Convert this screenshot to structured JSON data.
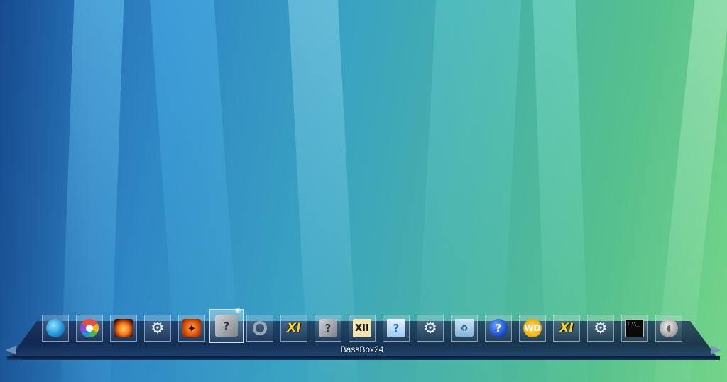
{
  "desktop": {
    "wallpaper": "aurora-streaks",
    "colors": {
      "left": "#1f5fa8",
      "mid": "#47b0a8",
      "right": "#74d488"
    }
  },
  "dock": {
    "hover_label": "BassBox24",
    "items": [
      {
        "name": "refresh-icon",
        "glyph": ""
      },
      {
        "name": "picasa-icon",
        "glyph": ""
      },
      {
        "name": "fire-icon",
        "glyph": ""
      },
      {
        "name": "gear-icon",
        "glyph": "⚙"
      },
      {
        "name": "orange-app-icon",
        "glyph": "✦"
      },
      {
        "name": "unknown-box-icon",
        "glyph": "?"
      },
      {
        "name": "circular-arrow-icon",
        "glyph": ""
      },
      {
        "name": "xi-icon",
        "glyph": "XI"
      },
      {
        "name": "unknown-box-icon",
        "glyph": "?"
      },
      {
        "name": "xii-icon",
        "glyph": "XII"
      },
      {
        "name": "help-document-icon",
        "glyph": "?"
      },
      {
        "name": "gear-icon",
        "glyph": "⚙"
      },
      {
        "name": "recycle-bin-icon",
        "glyph": "♻"
      },
      {
        "name": "help-icon",
        "glyph": "?"
      },
      {
        "name": "wd-icon",
        "glyph": "WD"
      },
      {
        "name": "xi-icon",
        "glyph": "XI"
      },
      {
        "name": "gear-icon",
        "glyph": "⚙"
      },
      {
        "name": "command-prompt-icon",
        "glyph": "C:\\_"
      },
      {
        "name": "speaker-icon",
        "glyph": "◖"
      }
    ]
  }
}
